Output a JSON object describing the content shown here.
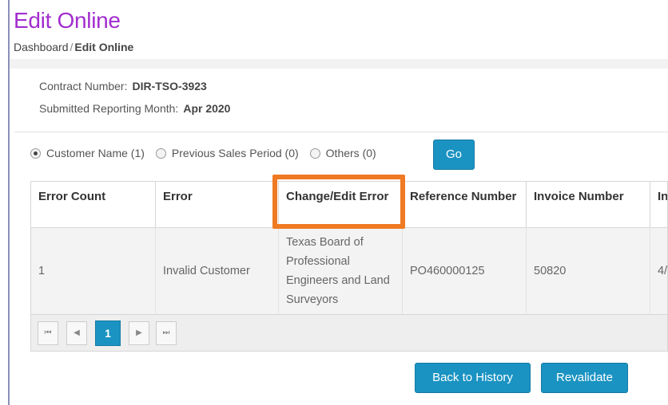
{
  "header": {
    "title": "Edit Online",
    "breadcrumb": {
      "home": "Dashboard",
      "separator": "/",
      "current": "Edit Online"
    }
  },
  "info": {
    "contract_label": "Contract Number:",
    "contract_value": "DIR-TSO-3923",
    "month_label": "Submitted Reporting Month:",
    "month_value": "Apr 2020"
  },
  "filters": {
    "options": [
      {
        "label": "Customer Name (1)",
        "checked": true
      },
      {
        "label": "Previous Sales Period (0)",
        "checked": false
      },
      {
        "label": "Others (0)",
        "checked": false
      }
    ],
    "go_label": "Go"
  },
  "table": {
    "columns": [
      "Error Count",
      "Error",
      "Change/Edit Error",
      "Reference Number",
      "Invoice Number",
      "In"
    ],
    "rows": [
      [
        "1",
        "Invalid Customer",
        "Texas Board of Professional Engineers and Land Surveyors",
        "PO460000125",
        "50820",
        "4/"
      ]
    ]
  },
  "pager": {
    "first": "⏮",
    "prev": "◀",
    "current": "1",
    "next": "▶",
    "last": "⏭"
  },
  "actions": {
    "back_label": "Back to History",
    "revalidate_label": "Revalidate"
  },
  "colors": {
    "title": "#a22ccf",
    "button": "#1a93c2",
    "highlight": "#ef7a22"
  }
}
